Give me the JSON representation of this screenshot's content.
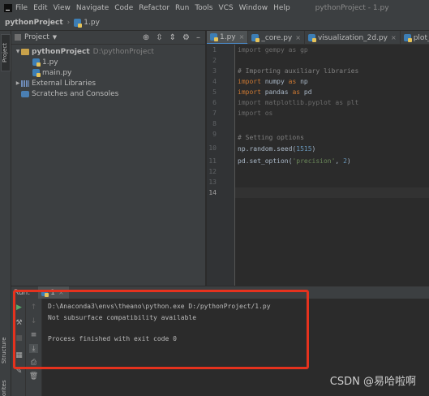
{
  "menubar": {
    "items": [
      "File",
      "Edit",
      "View",
      "Navigate",
      "Code",
      "Refactor",
      "Run",
      "Tools",
      "VCS",
      "Window",
      "Help"
    ],
    "window_title": "pythonProject - 1.py"
  },
  "breadcrumb": {
    "project": "pythonProject",
    "file": "1.py"
  },
  "left_strip": {
    "project": "Project",
    "structure": "Structure",
    "favorites": "Favorites"
  },
  "project_panel": {
    "header": "Project",
    "tree": {
      "root": {
        "label": "pythonProject",
        "path": "D:\\pythonProject"
      },
      "files": [
        "1.py",
        "main.py"
      ],
      "external": "External Libraries",
      "scratches": "Scratches and Consoles"
    }
  },
  "editor_tabs": [
    "1.py",
    "_core.py",
    "visualization_2d.py",
    "plot_api.py"
  ],
  "editor": {
    "line_numbers": [
      "1",
      "2",
      "3",
      "4",
      "5",
      "6",
      "7",
      "8",
      "9",
      "10",
      "11",
      "12",
      "13",
      "14"
    ],
    "code": {
      "l1": {
        "kw": "import",
        "rest": " gempy as gp"
      },
      "l3": "# Importing auxiliary libraries",
      "l4": {
        "kw1": "import",
        "mid": " numpy ",
        "kw2": "as",
        "rest": " np"
      },
      "l5": {
        "kw1": "import",
        "mid": " pandas ",
        "kw2": "as",
        "rest": " pd"
      },
      "l6": {
        "kw": "import",
        "rest": " matplotlib.pyplot as plt"
      },
      "l7": {
        "kw": "import",
        "rest": " os"
      },
      "l9": "# Setting options",
      "l10": {
        "pre": "np.random.seed(",
        "num": "1515",
        "post": ")"
      },
      "l11": {
        "pre": "pd.set_option(",
        "str": "'precision'",
        "mid": ", ",
        "num": "2",
        "post": ")"
      }
    }
  },
  "run": {
    "label": "Run:",
    "tab": "1",
    "output": [
      "D:\\Anaconda3\\envs\\theano\\python.exe D:/pythonProject/1.py",
      "Not subsurface compatibility available",
      "Process finished with exit code 0"
    ]
  },
  "watermark": "CSDN @易哈啦啊",
  "colors": {
    "highlight_box": "#e5321e",
    "keyword": "#cc7832",
    "comment": "#808080",
    "number": "#6897bb",
    "string": "#6a8759"
  }
}
